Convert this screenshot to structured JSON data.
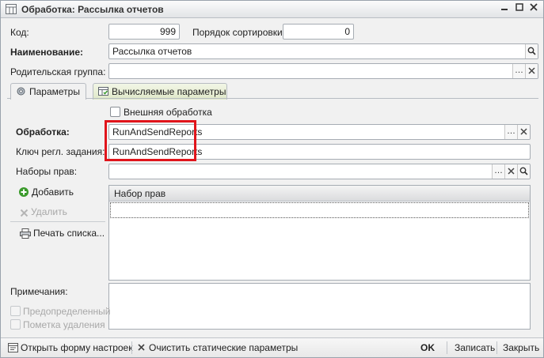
{
  "window": {
    "title": "Обработка: Рассылка отчетов",
    "icons": {
      "app": "table-icon",
      "minimize": "minimize-icon",
      "maximize": "maximize-icon",
      "close": "close-icon"
    }
  },
  "form": {
    "code_label": "Код:",
    "code_value": "999",
    "sort_label": "Порядок сортировки:",
    "sort_value": "0",
    "name_label": "Наименование:",
    "name_value": "Рассылка отчетов",
    "parent_label": "Родительская группа:",
    "parent_value": ""
  },
  "tabs": [
    {
      "label": "Параметры",
      "icon": "gear-icon",
      "active": true
    },
    {
      "label": "Вычисляемые параметры",
      "icon": "table-icon",
      "active": false
    }
  ],
  "params": {
    "external_label": "Внешняя обработка",
    "processing_label": "Обработка:",
    "processing_value": "RunAndSendReports",
    "schedule_key_label": "Ключ регл. задания:",
    "schedule_key_value": "RunAndSendReports",
    "rights_label": "Наборы прав:",
    "rights_value": ""
  },
  "sidebar": {
    "add": "Добавить",
    "delete": "Удалить",
    "print": "Печать списка..."
  },
  "grid": {
    "column": "Набор прав"
  },
  "notes": {
    "label": "Примечания:",
    "predefined": "Предопределенный",
    "deletion_mark": "Пометка удаления"
  },
  "bottombar": {
    "open_settings": "Открыть форму настроек",
    "clear_static": "Очистить статические параметры",
    "ok": "OK",
    "save": "Записать",
    "close": "Закрыть"
  },
  "colors": {
    "highlight": "#e0141b",
    "add_green": "#3a9a2b",
    "close_red": "#c0282b"
  }
}
